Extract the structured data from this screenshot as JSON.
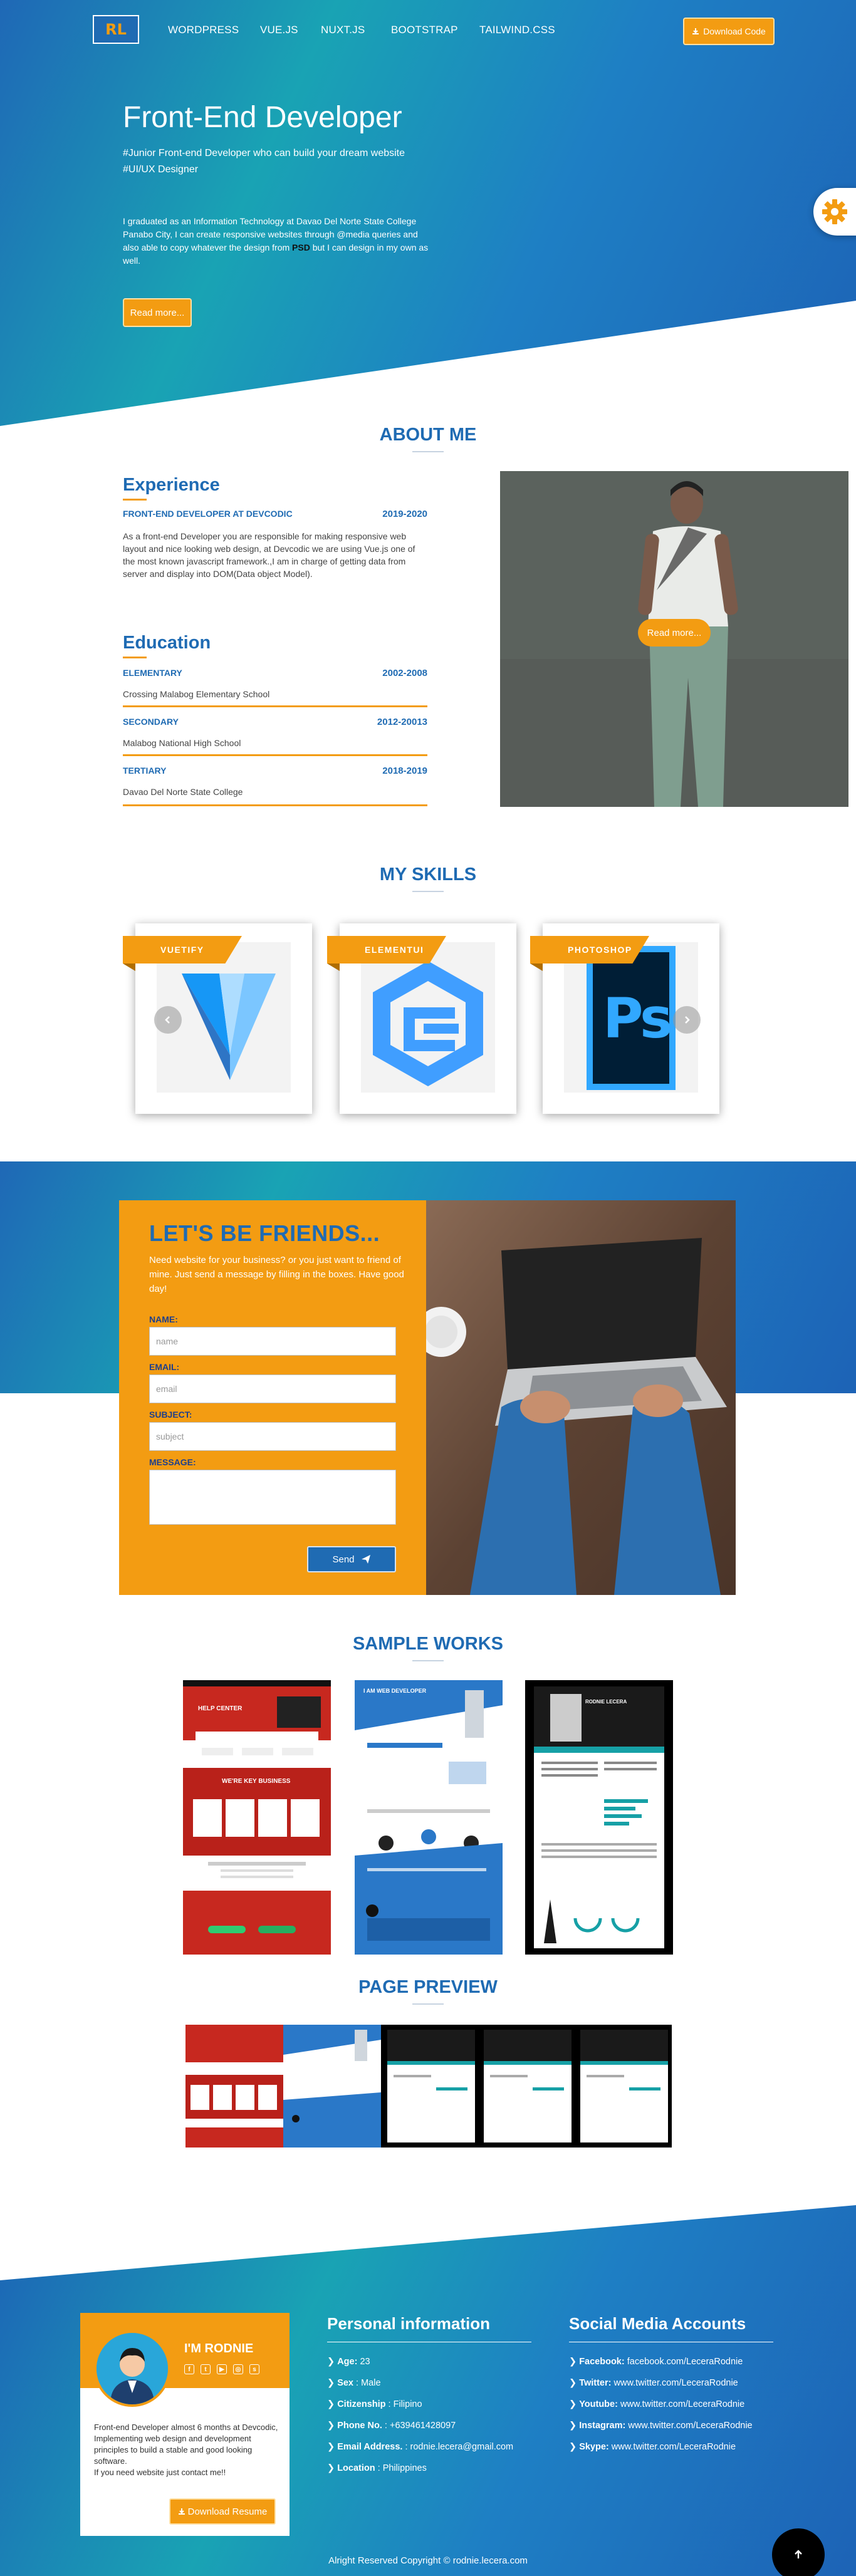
{
  "nav": {
    "logo": "RL",
    "links": [
      "WORDPRESS",
      "VUE.JS",
      "NUXT.JS",
      "BOOTSTRAP",
      "TAILWIND.CSS"
    ],
    "download_label": "Download Code"
  },
  "hero": {
    "title": "Front-End Developer",
    "subtitle_1": "#Junior Front-end Developer who can build your dream website",
    "subtitle_2": "#UI/UX Designer",
    "desc_1": "I graduated as an Information Technology at Davao Del Norte State College Panabo City, I can create responsive websites through @media queries and also able to copy whatever the design from ",
    "desc_psd": "PSD",
    "desc_2": " but I can design in my own as well.",
    "read_more": "Read more..."
  },
  "about": {
    "title": "ABOUT ME",
    "experience_title": "Experience",
    "experience": {
      "role": "FRONT-END DEVELOPER AT DEVCODIC",
      "date": "2019-2020",
      "text": "As a front-end Developer you are responsible for making responsive web layout and nice looking web design, at Devcodic we are using Vue.js one of the most known javascript framework.,I am in charge of getting data from server and display into DOM(Data object Model)."
    },
    "education_title": "Education",
    "education": [
      {
        "level": "ELEMENTARY",
        "date": "2002-2008",
        "school": "Crossing Malabog Elementary School"
      },
      {
        "level": "SECONDARY",
        "date": "2012-20013",
        "school": "Malabog National High School"
      },
      {
        "level": "TERTIARY",
        "date": "2018-2019",
        "school": "Davao Del Norte State College"
      }
    ],
    "photo_read_more": "Read more..."
  },
  "skills": {
    "title": "MY SKILLS",
    "items": [
      {
        "name": "VUETIFY",
        "icon": "vuetify-logo-icon"
      },
      {
        "name": "ELEMENTUI",
        "icon": "elementui-logo-icon"
      },
      {
        "name": "PHOTOSHOP",
        "icon": "photoshop-logo-icon"
      }
    ],
    "ps_text": "Ps"
  },
  "contact": {
    "title": "LET'S BE FRIENDS...",
    "desc": "Need website for your business? or you just want to friend of mine. Just send a message by filling in the boxes. Have good day!",
    "name_label": "NAME:",
    "name_placeholder": "name",
    "email_label": "EMAIL:",
    "email_placeholder": "email",
    "subject_label": "SUBJECT:",
    "subject_placeholder": "subject",
    "message_label": "MESSAGE:",
    "send_label": "Send"
  },
  "works": {
    "title": "SAMPLE WORKS",
    "preview_title": "PAGE PREVIEW",
    "red_header": "HELP CENTER",
    "red_section": "WE'RE KEY BUSINESS",
    "blue_header": "I AM WEB DEVELOPER",
    "dark_header": "RODNIE LECERA"
  },
  "footer": {
    "profile_name": "I'M RODNIE",
    "profile_text_1": "Front-end Developer almost 6 months at Devcodic, Implementing web design and development principles to build a stable and good looking software.",
    "profile_text_2": "If you need website just contact me!!",
    "resume_label": "Download Resume",
    "personal_title": "Personal information",
    "personal": [
      {
        "key": "Age:",
        "value": " 23"
      },
      {
        "key": "Sex",
        "value": " : Male"
      },
      {
        "key": "Citizenship",
        "value": " : Filipino"
      },
      {
        "key": "Phone No.",
        "value": " : +639461428097"
      },
      {
        "key": "Email Address.",
        "value": " : rodnie.lecera@gmail.com"
      },
      {
        "key": "Location",
        "value": " : Philippines"
      }
    ],
    "social_title": "Social Media Accounts",
    "social": [
      {
        "key": "Facebook:",
        "value": " facebook.com/LeceraRodnie"
      },
      {
        "key": "Twitter:",
        "value": " www.twitter.com/LeceraRodnie"
      },
      {
        "key": "Youtube:",
        "value": " www.twitter.com/LeceraRodnie"
      },
      {
        "key": "Instagram:",
        "value": " www.twitter.com/LeceraRodnie"
      },
      {
        "key": "Skype:",
        "value": " www.twitter.com/LeceraRodnie"
      }
    ],
    "copyright": "Alright Reserved Copyright © rodnie.lecera.com",
    "totop_icon": "arrow-up-icon"
  },
  "colors": {
    "brand_blue": "#1f6bb3",
    "accent_orange": "#f39c12",
    "teal": "#19a3b4"
  }
}
